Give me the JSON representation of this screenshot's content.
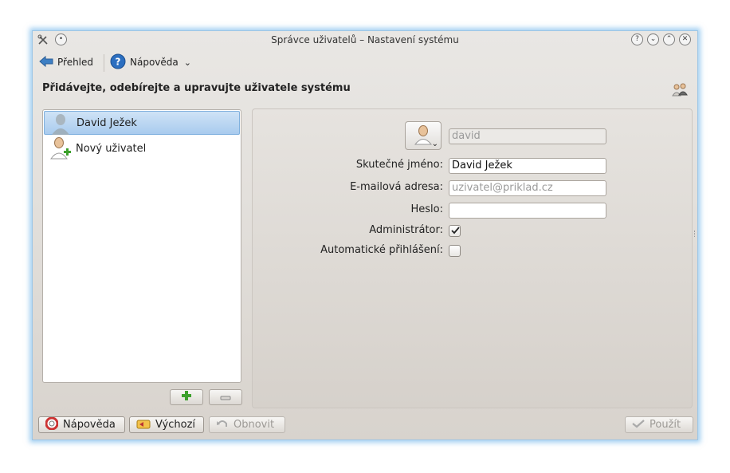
{
  "window": {
    "title": "Správce uživatelů – Nastavení systému"
  },
  "toolbar": {
    "overview_label": "Přehled",
    "help_label": "Nápověda"
  },
  "headline": "Přidávejte, odebírejte a upravujte uživatele systému",
  "users": [
    {
      "name": "David Ježek",
      "selected": true
    },
    {
      "name": "Nový uživatel",
      "selected": false
    }
  ],
  "form": {
    "username_value": "david",
    "real_name_label": "Skutečné jméno:",
    "real_name_value": "David Ježek",
    "email_label": "E-mailová adresa:",
    "email_placeholder": "uzivatel@priklad.cz",
    "password_label": "Heslo:",
    "password_value": "",
    "admin_label": "Administrátor:",
    "admin_checked": true,
    "autologin_label": "Automatické přihlášení:",
    "autologin_checked": false
  },
  "buttons": {
    "help": "Nápověda",
    "defaults": "Výchozí",
    "reset": "Obnovit",
    "apply": "Použít"
  },
  "colors": {
    "selection": "#a9cbee",
    "window_glow": "#5aaae6",
    "add_green": "#3ca02c"
  }
}
